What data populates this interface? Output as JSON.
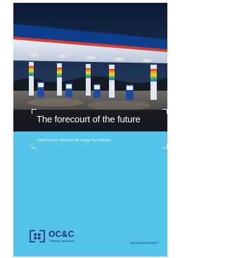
{
  "cover": {
    "title": "The forecourt of the future",
    "subtitle": "How electric vehicles will shape the industry",
    "background_color": "#55c4ea",
    "photo_description_icon": "gas-station-night-photo"
  },
  "brand": {
    "name": "OC&C",
    "sub": "Strategy consultants",
    "tagline": "uncommon sense™",
    "color": "#1a2a6e"
  }
}
